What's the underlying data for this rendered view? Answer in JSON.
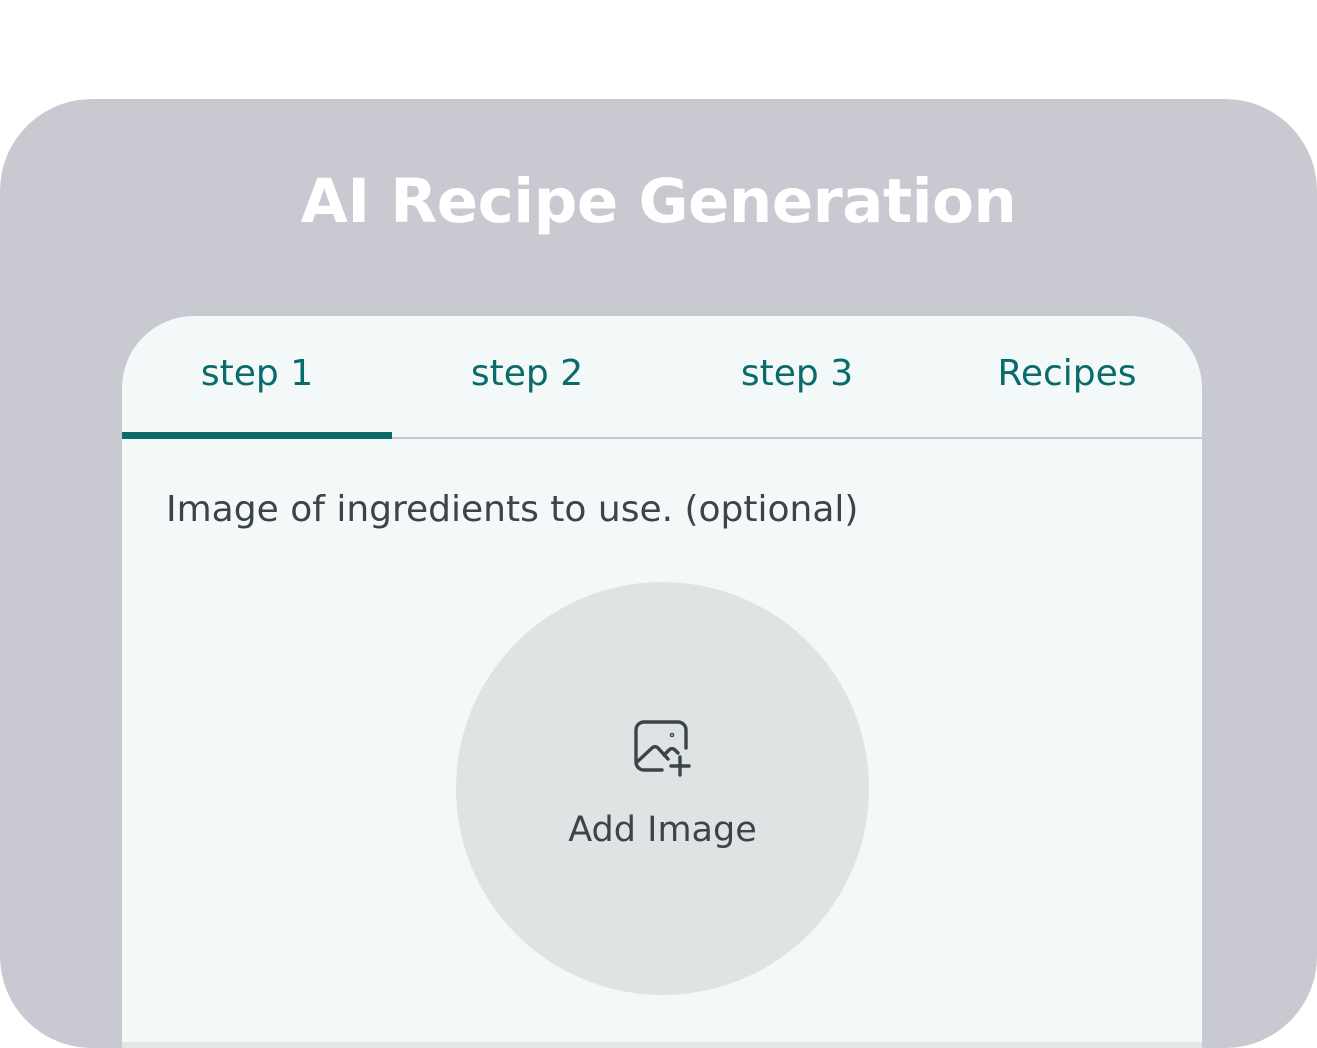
{
  "header": {
    "title": "AI Recipe Generation"
  },
  "tabs": [
    {
      "label": "step 1",
      "selected": true
    },
    {
      "label": "step 2",
      "selected": false
    },
    {
      "label": "step 3",
      "selected": false
    },
    {
      "label": "Recipes",
      "selected": false
    }
  ],
  "step1": {
    "section_label": "Image of ingredients to use. (optional)",
    "add_image": {
      "label": "Add Image",
      "icon": "add-photo-icon"
    }
  },
  "colors": {
    "outer_panel": "#c9c9d1",
    "card_background": "#f3f8f8",
    "accent": "#0b6b6b",
    "text": "#3d4447",
    "circle_button": "#dee3e4"
  }
}
